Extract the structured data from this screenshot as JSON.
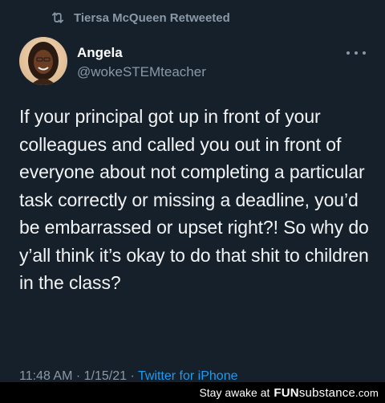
{
  "retweet": {
    "icon": "retweet-icon",
    "text": "Tiersa McQueen Retweeted"
  },
  "author": {
    "display_name": "Angela",
    "handle": "@wokeSTEMteacher"
  },
  "tweet": {
    "text": "If your principal got up in front of your colleagues and called you out in front of everyone about not completing a particular task correctly or missing a deadline, you’d be embarrassed or upset right?! So why do y’all think it’s okay to do that shit to children in the class?"
  },
  "meta": {
    "time": "11:48 AM",
    "date": "1/15/21",
    "separator": "·",
    "source": "Twitter for iPhone"
  },
  "watermark": {
    "prefix": "Stay awake at",
    "brand_bold": "FUN",
    "brand_rest": "substance",
    "brand_tld": ".com"
  },
  "colors": {
    "background": "#15202b",
    "secondary_text": "#8b98a5",
    "link": "#1d9bf0"
  }
}
